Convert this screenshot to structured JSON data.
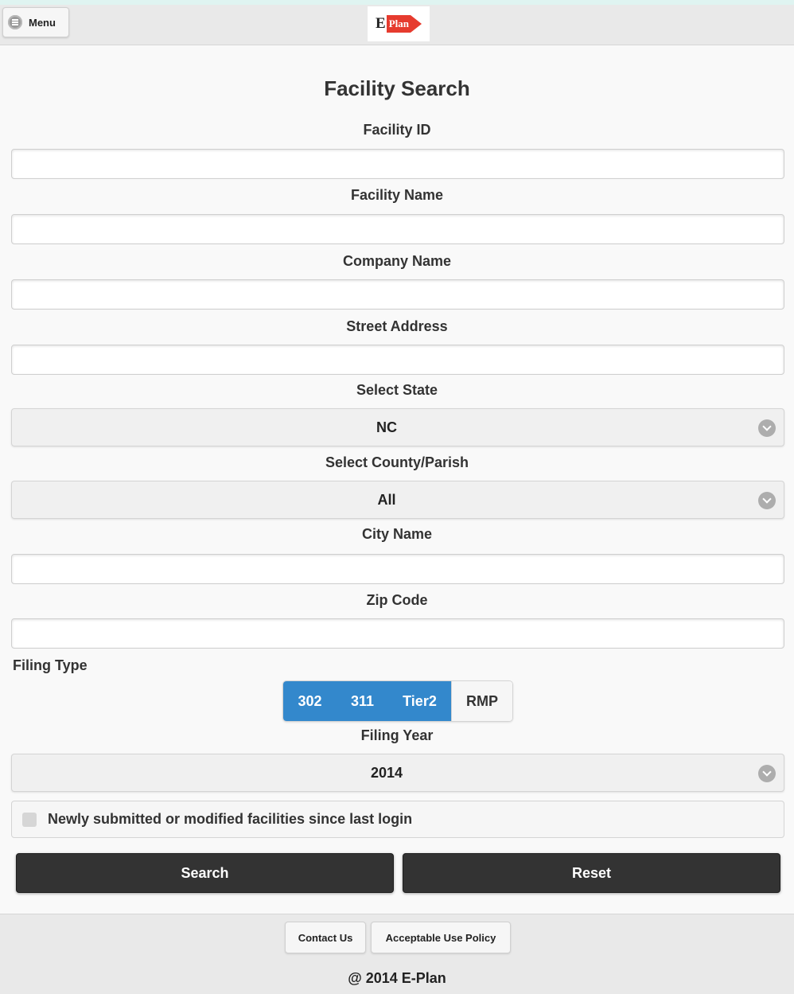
{
  "header": {
    "menu_label": "Menu",
    "logo_e": "E",
    "logo_plan": "Plan"
  },
  "title": "Facility Search",
  "fields": {
    "facility_id_label": "Facility ID",
    "facility_id_value": "",
    "facility_name_label": "Facility Name",
    "facility_name_value": "",
    "company_name_label": "Company Name",
    "company_name_value": "",
    "street_address_label": "Street Address",
    "street_address_value": "",
    "state_label": "Select State",
    "state_value": "NC",
    "county_label": "Select County/Parish",
    "county_value": "All",
    "city_label": "City Name",
    "city_value": "",
    "zip_label": "Zip Code",
    "zip_value": "",
    "filing_type_label": "Filing Type",
    "filing_year_label": "Filing Year",
    "filing_year_value": "2014"
  },
  "filing_types": [
    {
      "label": "302",
      "selected": true
    },
    {
      "label": "311",
      "selected": true
    },
    {
      "label": "Tier2",
      "selected": true
    },
    {
      "label": "RMP",
      "selected": false
    }
  ],
  "checkbox": {
    "label": "Newly submitted or modified facilities since last login",
    "checked": false
  },
  "buttons": {
    "search": "Search",
    "reset": "Reset"
  },
  "footer": {
    "contact": "Contact Us",
    "policy": "Acceptable Use Policy",
    "copyright": "@ 2014 E-Plan"
  },
  "colors": {
    "accent": "#3388cc",
    "dark_button": "#333333",
    "logo_red": "#e63b2e"
  }
}
